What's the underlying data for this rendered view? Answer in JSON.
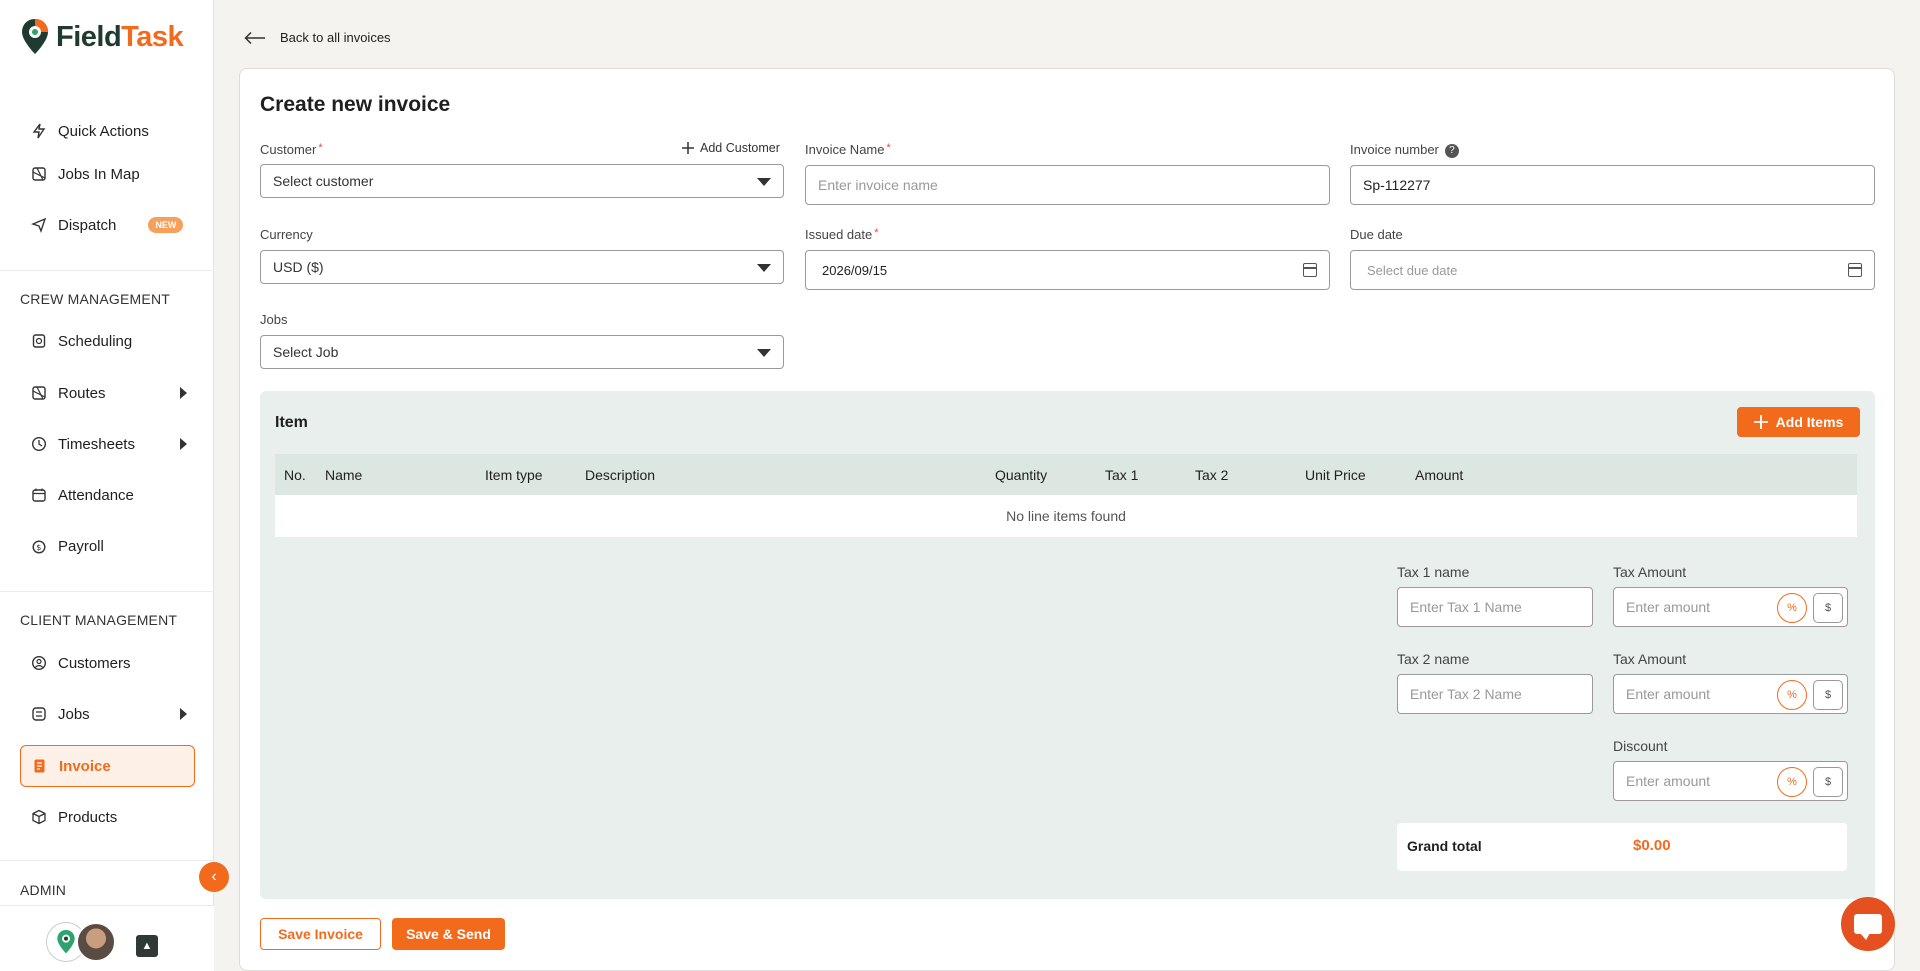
{
  "brand": {
    "name_part1": "Field",
    "name_part2": "Task",
    "accent": "#f26b1d",
    "dark": "#1f3b2f"
  },
  "sidebar": {
    "top_items": [
      {
        "label": "Quick Actions",
        "icon": "bolt-icon"
      },
      {
        "label": "Jobs In Map",
        "icon": "map-icon"
      },
      {
        "label": "Dispatch",
        "icon": "send-icon",
        "badge": "NEW"
      }
    ],
    "crew_title": "CREW MANAGEMENT",
    "crew_items": [
      {
        "label": "Scheduling",
        "icon": "schedule-icon"
      },
      {
        "label": "Routes",
        "icon": "routes-icon"
      },
      {
        "label": "Timesheets",
        "icon": "clock-icon"
      },
      {
        "label": "Attendance",
        "icon": "calendar-icon"
      },
      {
        "label": "Payroll",
        "icon": "payroll-icon"
      }
    ],
    "client_title": "CLIENT MANAGEMENT",
    "client_items": [
      {
        "label": "Customers",
        "icon": "user-icon"
      },
      {
        "label": "Jobs",
        "icon": "jobs-icon"
      },
      {
        "label": "Invoice",
        "icon": "invoice-icon"
      },
      {
        "label": "Products",
        "icon": "box-icon"
      }
    ],
    "admin_title": "ADMIN"
  },
  "back_link": "Back to all invoices",
  "form": {
    "title": "Create new invoice",
    "customer_label": "Customer",
    "add_customer": "Add Customer",
    "customer_placeholder": "Select customer",
    "invoice_name_label": "Invoice Name",
    "invoice_name_placeholder": "Enter invoice name",
    "invoice_number_label": "Invoice number",
    "invoice_number_value": "Sp-112277",
    "currency_label": "Currency",
    "currency_value": "USD ($)",
    "issued_label": "Issued date",
    "issued_value": "2026/09/15",
    "due_label": "Due date",
    "due_placeholder": "Select due date",
    "jobs_label": "Jobs",
    "jobs_placeholder": "Select Job"
  },
  "items": {
    "title": "Item",
    "add_button": "Add Items",
    "columns": [
      "No.",
      "Name",
      "Item type",
      "Description",
      "Quantity",
      "Tax 1",
      "Tax 2",
      "Unit Price",
      "Amount"
    ],
    "empty_text": "No line items found"
  },
  "totals": {
    "tax1_name_label": "Tax 1 name",
    "tax1_name_placeholder": "Enter Tax 1 Name",
    "tax_amount_label": "Tax Amount",
    "amount_placeholder": "Enter amount",
    "tax2_name_label": "Tax 2 name",
    "tax2_name_placeholder": "Enter Tax 2 Name",
    "discount_label": "Discount",
    "pct_symbol": "%",
    "usd_symbol": "$",
    "grand_total_label": "Grand total",
    "grand_total_value": "$0.00"
  },
  "actions": {
    "save": "Save Invoice",
    "save_send": "Save & Send"
  }
}
